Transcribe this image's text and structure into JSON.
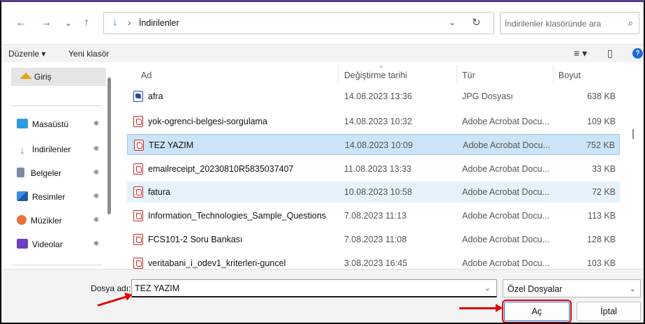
{
  "nav": {
    "back_icon": "←",
    "forward_icon": "→",
    "recent_icon": "⌄",
    "up_icon": "↑",
    "location_icon": "↓",
    "location_sep": "›",
    "location": "İndirilenler",
    "address_dropdown": "⌄",
    "refresh_icon": "↻",
    "search_placeholder": "İndirilenler klasöründe ara",
    "search_icon": "⌕"
  },
  "toolbar": {
    "organize_label": "Düzenle ▾",
    "new_folder_label": "Yeni klasör",
    "view_icon": "≡ ▾",
    "pane_icon": "▯",
    "help_icon": "?"
  },
  "sidebar": {
    "home_label": "Giriş",
    "items": [
      {
        "label": "Masaüstü",
        "pin": "✱"
      },
      {
        "label": "İndirilenler",
        "pin": "✱"
      },
      {
        "label": "Belgeler",
        "pin": "✱"
      },
      {
        "label": "Resimler",
        "pin": "✱"
      },
      {
        "label": "Müzikler",
        "pin": "✱"
      },
      {
        "label": "Videolar",
        "pin": "✱"
      }
    ]
  },
  "columns": {
    "name": "Ad",
    "date": "Değiştirme tarihi",
    "type": "Tür",
    "size": "Boyut",
    "sort_icon": "⌄"
  },
  "files": [
    {
      "name": "afra",
      "date": "14.08.2023 13:36",
      "type": "JPG Dosyası",
      "size": "638 KB"
    },
    {
      "name": "yok-ogrenci-belgesi-sorgulama",
      "date": "14.08.2023 10:32",
      "type": "Adobe Acrobat Docu...",
      "size": "109 KB"
    },
    {
      "name": "TEZ YAZIM",
      "date": "14.08.2023 10:09",
      "type": "Adobe Acrobat Docu...",
      "size": "752 KB"
    },
    {
      "name": "emailreceipt_20230810R5835037407",
      "date": "11.08.2023 13:33",
      "type": "Adobe Acrobat Docu...",
      "size": "33 KB"
    },
    {
      "name": "fatura",
      "date": "10.08.2023 10:58",
      "type": "Adobe Acrobat Docu...",
      "size": "72 KB"
    },
    {
      "name": "Information_Technologies_Sample_Questions",
      "date": "7.08.2023 11:13",
      "type": "Adobe Acrobat Docu...",
      "size": "113 KB"
    },
    {
      "name": "FCS101-2 Soru Bankası",
      "date": "7.08.2023 11:08",
      "type": "Adobe Acrobat Docu...",
      "size": "128 KB"
    },
    {
      "name": "veritabani_i_odev1_kriterleri-guncel",
      "date": "3.08.2023 16:45",
      "type": "Adobe Acrobat Docu...",
      "size": "103 KB"
    }
  ],
  "footer": {
    "filename_label": "Dosya adı:",
    "filename_value": "TEZ YAZIM",
    "dropdown_icon": "⌄",
    "filter_value": "Özel Dosyalar",
    "open_label": "Aç",
    "cancel_label": "İptal"
  },
  "colors": {
    "accent": "#1a6bd8",
    "selection": "#cce4f7",
    "annotation": "#e00000"
  }
}
